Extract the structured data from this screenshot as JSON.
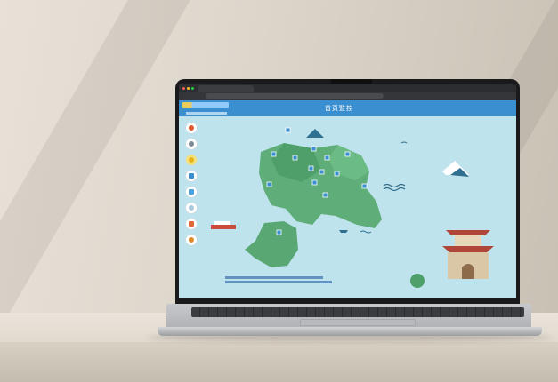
{
  "screen": {
    "header_title": "首頁監控"
  },
  "colors": {
    "header": "#3a8fd0",
    "sea": "#bfe3ec",
    "land": "#5fae7a",
    "wall": "#ddd6cb"
  },
  "icons": [
    "fire-icon",
    "gauge-icon",
    "sun-icon",
    "document-icon",
    "file-icon",
    "cloud-icon",
    "mail-icon",
    "globe-icon"
  ]
}
